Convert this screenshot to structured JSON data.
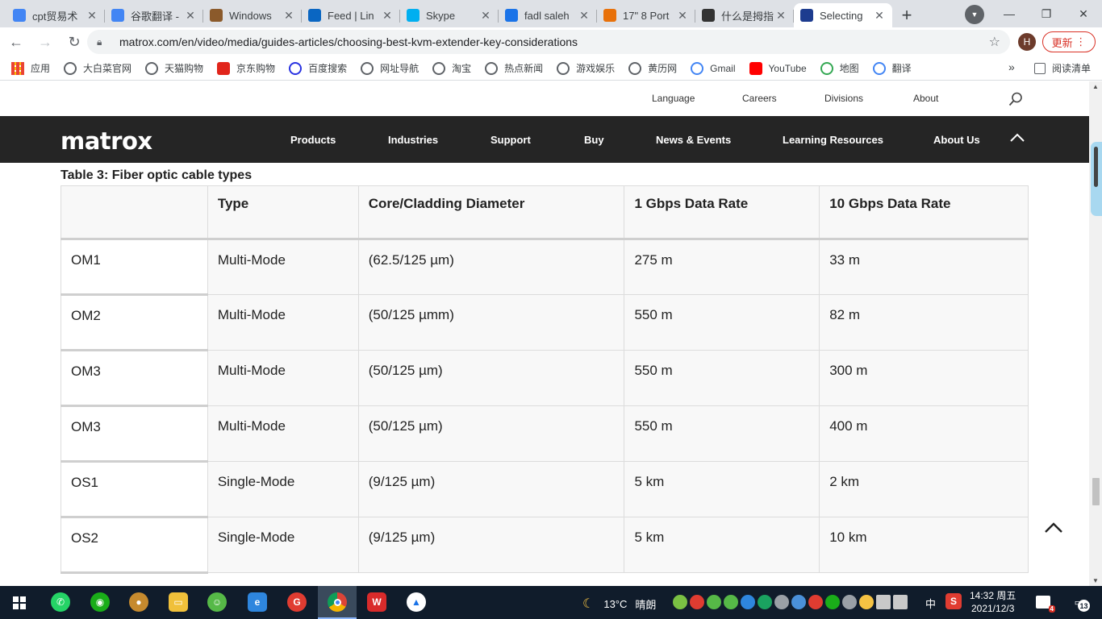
{
  "browser": {
    "tabs": [
      {
        "title": "cpt贸易术",
        "favicon": "google-icon",
        "color": "#4285f4"
      },
      {
        "title": "谷歌翻译 -",
        "favicon": "google-icon",
        "color": "#4285f4"
      },
      {
        "title": "Windows",
        "favicon": "acorn-icon",
        "color": "#8b5a2b"
      },
      {
        "title": "Feed | Lin",
        "favicon": "linkedin-icon",
        "color": "#0a66c2"
      },
      {
        "title": "Skype",
        "favicon": "skype-icon",
        "color": "#00aff0"
      },
      {
        "title": "fadl saleh",
        "favicon": "link-icon",
        "color": "#1a73e8"
      },
      {
        "title": "17\" 8 Port",
        "favicon": "grid-icon",
        "color": "#e8710a"
      },
      {
        "title": "什么是拇指",
        "favicon": "graduation-icon",
        "color": "#333333"
      },
      {
        "title": "Selecting",
        "favicon": "matrox-m-icon",
        "color": "#1d3c8f",
        "active": true
      }
    ],
    "url": "matrox.com/en/video/media/guides-articles/choosing-best-kvm-extender-key-considerations",
    "profile_initial": "H",
    "update_label": "更新",
    "bookmarks": [
      {
        "label": "应用",
        "icon": "apps-grid-icon"
      },
      {
        "label": "大白菜官网",
        "icon": "globe-icon"
      },
      {
        "label": "天猫购物",
        "icon": "globe-icon"
      },
      {
        "label": "京东购物",
        "icon": "jd-icon"
      },
      {
        "label": "百度搜索",
        "icon": "baidu-paw-icon"
      },
      {
        "label": "网址导航",
        "icon": "globe-icon"
      },
      {
        "label": "淘宝",
        "icon": "globe-icon"
      },
      {
        "label": "热点新闻",
        "icon": "globe-icon"
      },
      {
        "label": "游戏娱乐",
        "icon": "globe-icon"
      },
      {
        "label": "黄历网",
        "icon": "globe-icon"
      },
      {
        "label": "Gmail",
        "icon": "google-icon"
      },
      {
        "label": "YouTube",
        "icon": "youtube-icon"
      },
      {
        "label": "地图",
        "icon": "maps-icon"
      },
      {
        "label": "翻译",
        "icon": "translate-icon"
      }
    ],
    "more_bookmarks": "»",
    "reading_list": "阅读清单"
  },
  "site": {
    "utility_links": [
      "Language",
      "Careers",
      "Divisions",
      "About"
    ],
    "logo": "matrox",
    "nav": [
      "Products",
      "Industries",
      "Support",
      "Buy",
      "News & Events",
      "Learning Resources",
      "About Us"
    ]
  },
  "article": {
    "table_caption": "Table 3: Fiber optic cable types",
    "table": {
      "headers": [
        "",
        "Type",
        "Core/Cladding Diameter",
        "1 Gbps Data Rate",
        "10 Gbps Data Rate"
      ],
      "rows": [
        [
          "OM1",
          "Multi-Mode",
          "(62.5/125 µm)",
          "275 m",
          "33 m"
        ],
        [
          "OM2",
          "Multi-Mode",
          "(50/125 µmm)",
          "550 m",
          "82 m"
        ],
        [
          "OM3",
          "Multi-Mode",
          "(50/125 µm)",
          "550 m",
          "300 m"
        ],
        [
          "OM3",
          "Multi-Mode",
          "(50/125 µm)",
          "550 m",
          "400 m"
        ],
        [
          "OS1",
          "Single-Mode",
          "(9/125 µm)",
          "5 km",
          "2 km"
        ],
        [
          "OS2",
          "Single-Mode",
          "(9/125 µm)",
          "5 km",
          "10 km"
        ]
      ]
    }
  },
  "taskbar": {
    "weather_temp": "13°C",
    "weather_desc": "晴朗",
    "ime": "中",
    "time": "14:32 周五",
    "date": "2021/12/3",
    "notification_count": "13",
    "mail_badge": "4"
  }
}
